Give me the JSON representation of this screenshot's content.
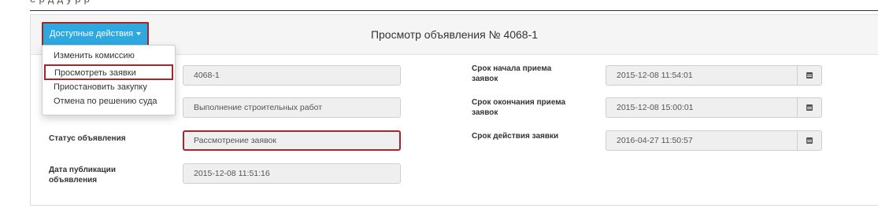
{
  "header_fragment": "е                    р    д        д    у                                               р               р",
  "panel": {
    "title": "Просмотр объявления № 4068-1",
    "actions_label": "Доступные действия"
  },
  "menu": {
    "items": [
      "Изменить комиссию",
      "Просмотреть заявки",
      "Приостановить закупку",
      "Отмена по решению суда"
    ]
  },
  "form": {
    "number_value": "4068-1",
    "subject_value": "Выполнение строительных работ",
    "status_label": "Статус объявления",
    "status_value": "Рассмотрение заявок",
    "pub_label_1": "Дата публикации",
    "pub_label_2": "объявления",
    "pub_value": "2015-12-08 11:51:16",
    "start_label_1": "Срок начала приема",
    "start_label_2": "заявок",
    "start_value": "2015-12-08 11:54:01",
    "end_label_1": "Срок окончания приема",
    "end_label_2": "заявок",
    "end_value": "2015-12-08 15:00:01",
    "validity_label": "Срок действия заявки",
    "validity_value": "2016-04-27 11:50:57"
  },
  "icons": {
    "calendar": "calendar-icon",
    "caret": "caret-down-icon"
  },
  "colors": {
    "accent_button": "#2ea9e0",
    "highlight_border": "#a3262a",
    "field_background": "#efefef"
  }
}
